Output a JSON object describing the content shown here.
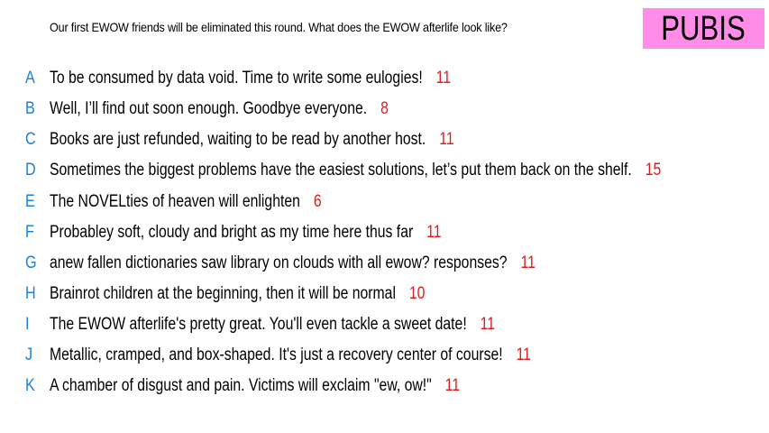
{
  "header": {
    "prompt": "Our first EWOW friends will be eliminated this round. What does the EWOW afterlife look like?",
    "badge": "PUBIS",
    "badge_color": "#ff8ce6"
  },
  "colors": {
    "letter": "#1f7fd6",
    "score": "#dd1c1c"
  },
  "responses": [
    {
      "letter": "A",
      "text": "To be consumed by data void. Time to write some eulogies!",
      "score": "11"
    },
    {
      "letter": "B",
      "text": "Well, I’ll find out soon enough. Goodbye everyone.",
      "score": "8"
    },
    {
      "letter": "C",
      "text": "Books are just refunded, waiting to be read by another host.",
      "score": "11"
    },
    {
      "letter": "D",
      "text": "Sometimes the biggest problems have the easiest solutions, let’s put them back on the shelf.",
      "score": "15"
    },
    {
      "letter": "E",
      "text": "The NOVELties of heaven will enlighten",
      "score": "6"
    },
    {
      "letter": "F",
      "text": "Probabley soft, cloudy and bright as my time here thus far",
      "score": "11"
    },
    {
      "letter": "G",
      "text": "anew fallen dictionaries saw library on clouds with all ewow? responses?",
      "score": "11"
    },
    {
      "letter": "H",
      "text": "Brainrot children at the beginning, then it will be normal",
      "score": "10"
    },
    {
      "letter": "I",
      "text": "The EWOW afterlife's pretty great. You'll even tackle a sweet date!",
      "score": "11"
    },
    {
      "letter": "J",
      "text": "Metallic, cramped, and box-shaped. It's just a recovery center of course!",
      "score": "11"
    },
    {
      "letter": "K",
      "text": "A chamber of disgust and pain. Victims will exclaim \"ew, ow!\"",
      "score": "11"
    }
  ]
}
